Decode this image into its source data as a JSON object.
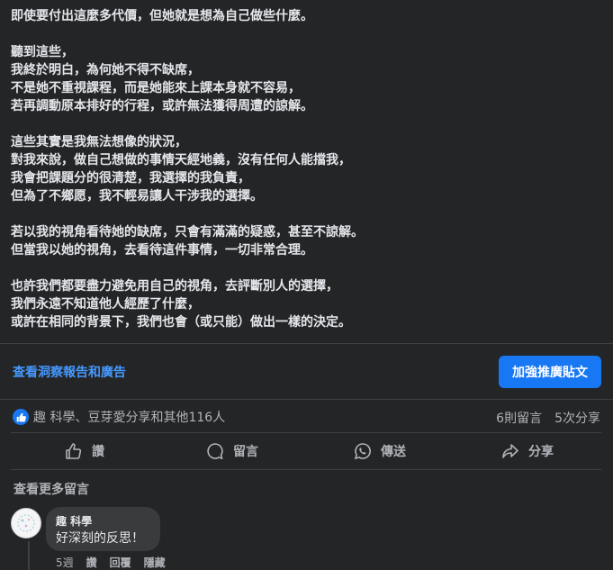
{
  "post": {
    "paragraphs": [
      [
        "即使要付出這麼多代價，但她就是想為自己做些什麼。"
      ],
      [
        "聽到這些，",
        "我終於明白，為何她不得不缺席，",
        "不是她不重視課程，而是她能來上課本身就不容易，",
        "若再調動原本排好的行程，或許無法獲得周遭的諒解。"
      ],
      [
        "這些其實是我無法想像的狀況，",
        "對我來說，做自己想做的事情天經地義，沒有任何人能擋我，",
        "我會把課題分的很清楚，我選擇的我負責，",
        "但為了不鄉愿，我不輕易讓人干涉我的選擇。"
      ],
      [
        "若以我的視角看待她的缺席，只會有滿滿的疑惑，甚至不諒解。",
        "但當我以她的視角，去看待這件事情，一切非常合理。"
      ],
      [
        "也許我們都要盡力避免用自己的視角，去評斷別人的選擇，",
        "我們永遠不知道他人經歷了什麼，",
        "或許在相同的背景下，我們也會（或只能）做出一樣的決定。"
      ]
    ]
  },
  "insights": {
    "link_label": "查看洞察報告和廣告",
    "boost_label": "加強推廣貼文"
  },
  "reactions": {
    "text": "趣 科學、豆芽愛分享和其他116人",
    "comments": "6則留言",
    "shares": "5次分享"
  },
  "actions": {
    "like": "讚",
    "comment": "留言",
    "send": "傳送",
    "share": "分享"
  },
  "more_comments": "查看更多留言",
  "comment": {
    "author": "趣 科學",
    "text": "好深刻的反思！",
    "time": "5週",
    "like": "讚",
    "reply": "回覆",
    "hide": "隱藏"
  },
  "colors": {
    "accent": "#1877f2",
    "link": "#4599ff",
    "background": "#242526"
  }
}
